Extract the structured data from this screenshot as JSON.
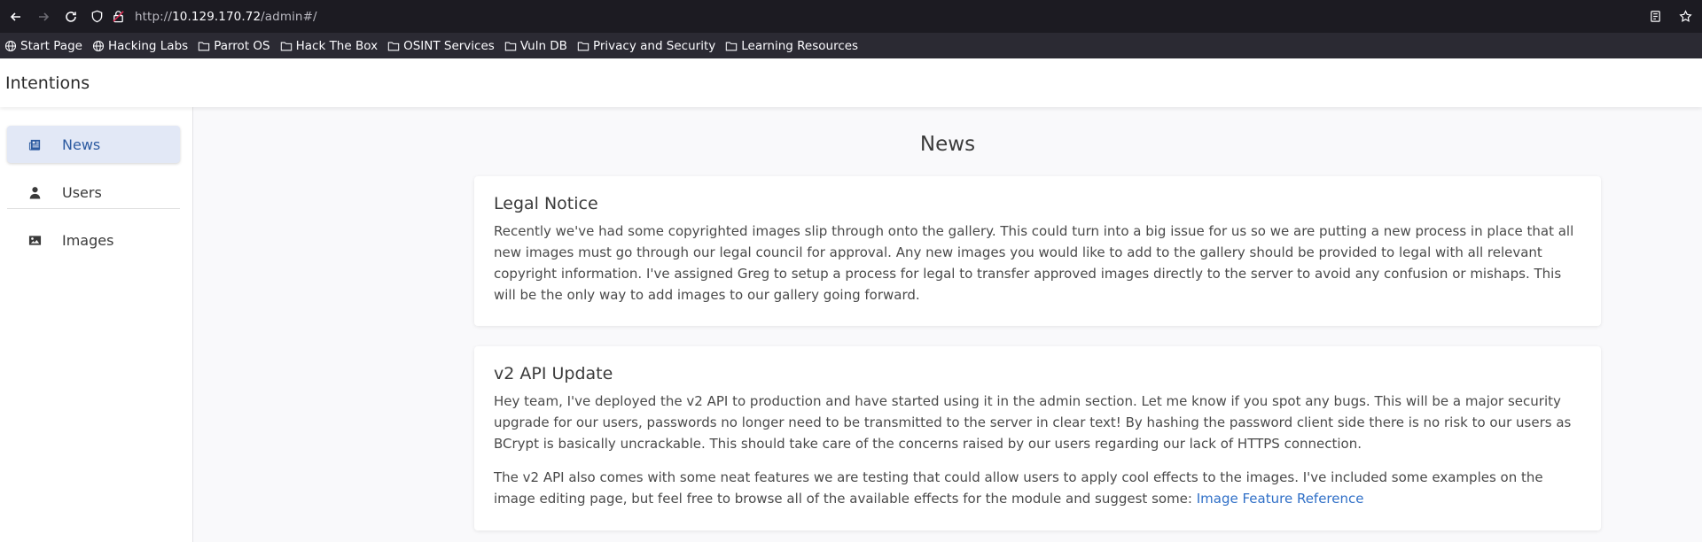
{
  "browser": {
    "url_prefix": "http://",
    "url_host": "10.129.170.72",
    "url_path": "/admin#/",
    "bookmarks": [
      {
        "label": "Start Page",
        "icon": "globe-icon"
      },
      {
        "label": "Hacking Labs",
        "icon": "globe-icon"
      },
      {
        "label": "Parrot OS",
        "icon": "folder-icon"
      },
      {
        "label": "Hack The Box",
        "icon": "folder-icon"
      },
      {
        "label": "OSINT Services",
        "icon": "folder-icon"
      },
      {
        "label": "Vuln DB",
        "icon": "folder-icon"
      },
      {
        "label": "Privacy and Security",
        "icon": "folder-icon"
      },
      {
        "label": "Learning Resources",
        "icon": "folder-icon"
      }
    ]
  },
  "app": {
    "title": "Intentions"
  },
  "sidebar": {
    "items": [
      {
        "label": "News",
        "icon": "newspaper-icon",
        "active": true
      },
      {
        "label": "Users",
        "icon": "user-icon",
        "active": false
      },
      {
        "label": "Images",
        "icon": "image-icon",
        "active": false
      }
    ]
  },
  "main": {
    "title": "News",
    "cards": [
      {
        "title": "Legal Notice",
        "body": "Recently we've had some copyrighted images slip through onto the gallery. This could turn into a big issue for us so we are putting a new process in place that all new images must go through our legal council for approval. Any new images you would like to add to the gallery should be provided to legal with all relevant copyright information. I've assigned Greg to setup a process for legal to transfer approved images directly to the server to avoid any confusion or mishaps. This will be the only way to add images to our gallery going forward."
      },
      {
        "title": "v2 API Update",
        "body": "Hey team, I've deployed the v2 API to production and have started using it in the admin section. Let me know if you spot any bugs. This will be a major security upgrade for our users, passwords no longer need to be transmitted to the server in clear text! By hashing the password client side there is no risk to our users as BCrypt is basically uncrackable. This should take care of the concerns raised by our users regarding our lack of HTTPS connection.",
        "body2": "The v2 API also comes with some neat features we are testing that could allow users to apply cool effects to the images. I've included some examples on the image editing page, but feel free to browse all of the available effects for the module and suggest some:",
        "link": "Image Feature Reference"
      }
    ]
  },
  "colors": {
    "accent": "#2c5aa0",
    "link": "#2f6fc7",
    "active_bg": "#e2e8f6",
    "chrome_dark": "#1c1b22"
  }
}
